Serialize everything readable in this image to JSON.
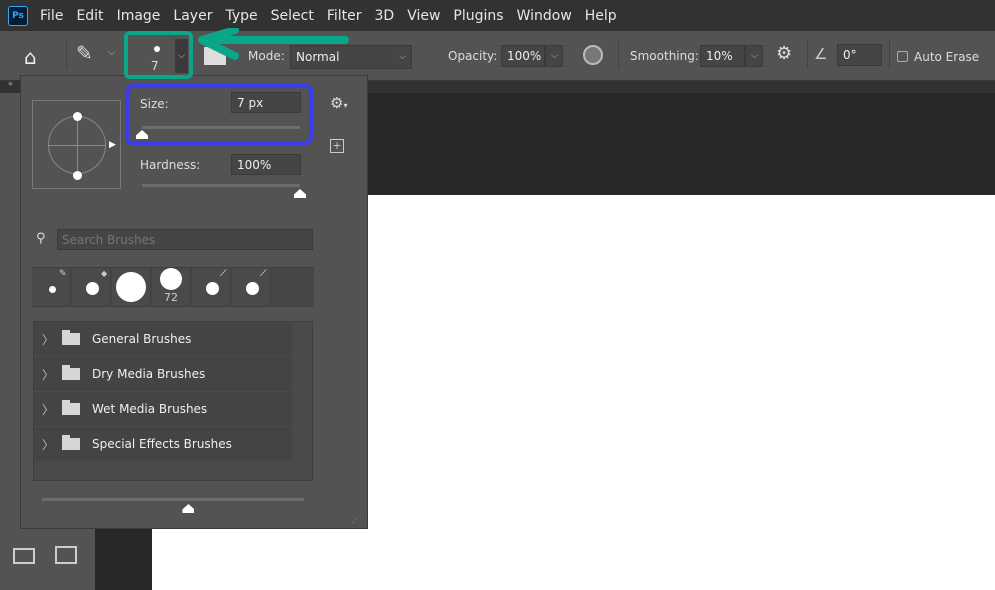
{
  "menu": {
    "logo": "Ps",
    "items": [
      "File",
      "Edit",
      "Image",
      "Layer",
      "Type",
      "Select",
      "Filter",
      "3D",
      "View",
      "Plugins",
      "Window",
      "Help"
    ]
  },
  "options": {
    "brush_size": "7",
    "mode_label": "Mode:",
    "mode_value": "Normal",
    "opacity_label": "Opacity:",
    "opacity_value": "100%",
    "smoothing_label": "Smoothing:",
    "smoothing_value": "10%",
    "angle_value": "0°",
    "auto_erase_label": "Auto Erase",
    "auto_erase_checked": false
  },
  "brush_panel": {
    "size_label": "Size:",
    "size_value": "7 px",
    "size_fraction": 0.0,
    "hardness_label": "Hardness:",
    "hardness_value": "100%",
    "hardness_fraction": 1.0,
    "search_placeholder": "Search Brushes",
    "recent_brush_label": "72",
    "folders": [
      "General Brushes",
      "Dry Media Brushes",
      "Wet Media Brushes",
      "Special Effects Brushes"
    ],
    "preview_size_fraction": 0.62
  },
  "annotations": {
    "green_color": "#0aa68a",
    "blue_color": "#3b3bf0"
  }
}
